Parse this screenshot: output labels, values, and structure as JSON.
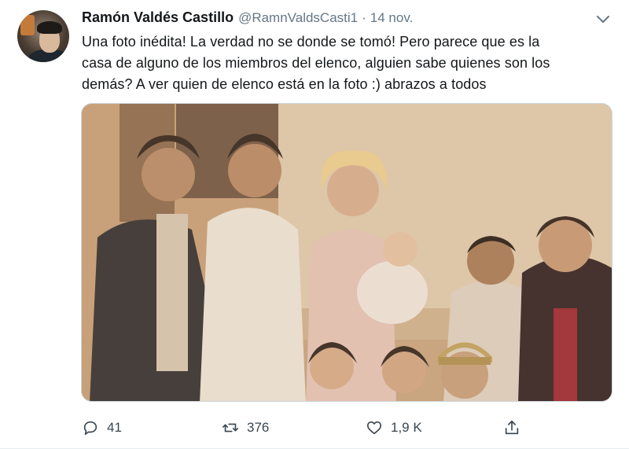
{
  "tweet": {
    "author_name": "Ramón Valdés Castillo",
    "handle": "@RamnValdsCasti1",
    "separator": "·",
    "date": "14 nov.",
    "text_lines": [
      "Una foto inédita! La verdad no se donde se tomó! Pero parece que es la",
      "casa de alguno de los miembros del elenco, alguien sabe quienes son los",
      "demás? A ver quien de elenco está en la foto :) abrazos a todos"
    ]
  },
  "actions": {
    "reply_count": "41",
    "retweet_count": "376",
    "like_count": "1,9 K"
  },
  "icons": {
    "caret": "chevron-down-icon",
    "reply": "reply-icon",
    "retweet": "retweet-icon",
    "like": "heart-icon",
    "share": "share-icon"
  },
  "colors": {
    "text": "#14171a",
    "secondary": "#657786",
    "border": "#ccd6dd"
  }
}
